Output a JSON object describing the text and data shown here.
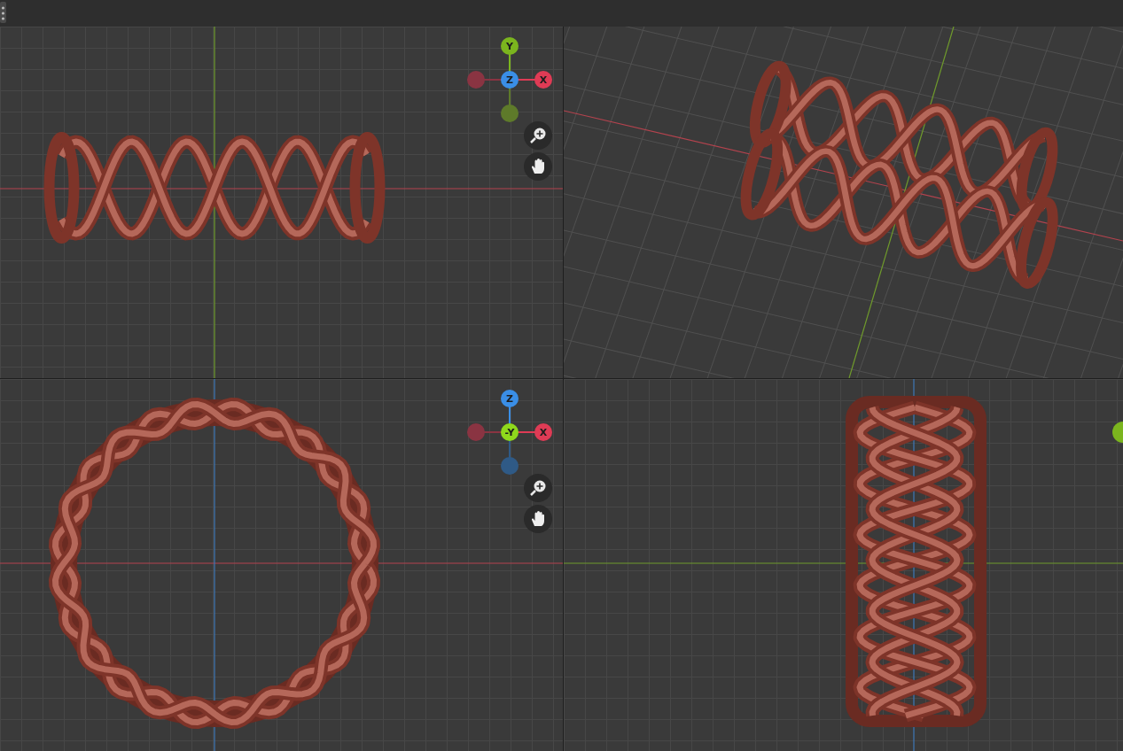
{
  "viewports": [
    {
      "kind": "front",
      "nav_buttons": [
        {
          "kind": "zoom"
        },
        {
          "kind": "pan"
        }
      ],
      "gizmo": [
        {
          "kind": "top",
          "label": "Y",
          "color": "#7bb51e"
        },
        {
          "kind": "left",
          "color": "#8a3442"
        },
        {
          "kind": "center",
          "label": "Z",
          "color": "#3a8ee6"
        },
        {
          "kind": "right",
          "label": "X",
          "color": "#df3b55"
        },
        {
          "kind": "bottom",
          "color": "#5e7a2a"
        }
      ]
    },
    {
      "kind": "perspective"
    },
    {
      "kind": "top",
      "nav_buttons": [
        {
          "kind": "zoom"
        },
        {
          "kind": "pan"
        }
      ],
      "gizmo": [
        {
          "kind": "top",
          "label": "Z",
          "color": "#3a8ee6"
        },
        {
          "kind": "left",
          "color": "#8a3442"
        },
        {
          "kind": "center",
          "label": "-Y",
          "color": "#8fd81c"
        },
        {
          "kind": "right",
          "label": "X",
          "color": "#df3b55"
        },
        {
          "kind": "bottom",
          "color": "#2f5a86"
        }
      ]
    },
    {
      "kind": "side",
      "gizmo": [
        {
          "kind": "edge",
          "color": "#7bb51e"
        }
      ]
    }
  ]
}
